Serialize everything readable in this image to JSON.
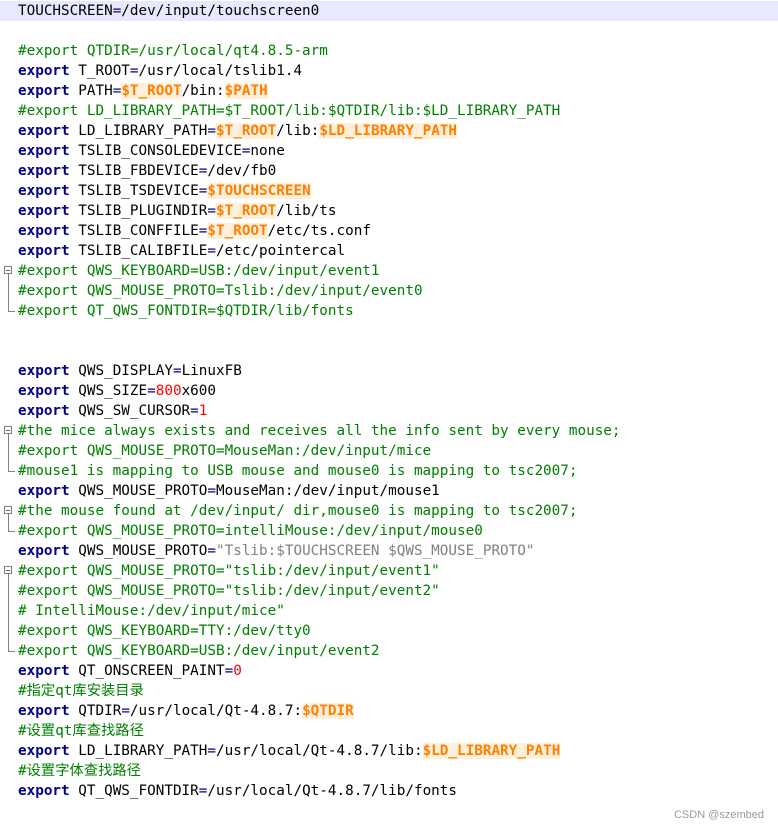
{
  "editor": {
    "lines": [
      {
        "hl": true,
        "fold": "none",
        "tokens": [
          {
            "t": "TOUCHSCREEN"
          },
          {
            "t": "=",
            "c": "op"
          },
          {
            "t": "/dev/input/touchscreen0"
          }
        ]
      },
      {
        "fold": "none",
        "tokens": []
      },
      {
        "fold": "none",
        "tokens": [
          {
            "t": "#export QTDIR=/usr/local/qt4.8.5-arm",
            "c": "cm"
          }
        ]
      },
      {
        "fold": "none",
        "tokens": [
          {
            "t": "export",
            "c": "kw"
          },
          {
            "t": " T_ROOT"
          },
          {
            "t": "=",
            "c": "op"
          },
          {
            "t": "/usr/local/tslib1.4"
          }
        ]
      },
      {
        "fold": "none",
        "tokens": [
          {
            "t": "export",
            "c": "kw"
          },
          {
            "t": " PATH"
          },
          {
            "t": "=",
            "c": "op"
          },
          {
            "t": "$T_ROOT",
            "c": "var"
          },
          {
            "t": "/bin:"
          },
          {
            "t": "$PATH",
            "c": "var"
          }
        ]
      },
      {
        "fold": "none",
        "tokens": [
          {
            "t": "#export LD_LIBRARY_PATH=$T_ROOT/lib:$QTDIR/lib:$LD_LIBRARY_PATH",
            "c": "cm"
          }
        ]
      },
      {
        "fold": "none",
        "tokens": [
          {
            "t": "export",
            "c": "kw"
          },
          {
            "t": " LD_LIBRARY_PATH"
          },
          {
            "t": "=",
            "c": "op"
          },
          {
            "t": "$T_ROOT",
            "c": "var"
          },
          {
            "t": "/lib:"
          },
          {
            "t": "$LD_LIBRARY_PATH",
            "c": "var"
          }
        ]
      },
      {
        "fold": "none",
        "tokens": [
          {
            "t": "export",
            "c": "kw"
          },
          {
            "t": " TSLIB_CONSOLEDEVICE"
          },
          {
            "t": "=",
            "c": "op"
          },
          {
            "t": "none"
          }
        ]
      },
      {
        "fold": "none",
        "tokens": [
          {
            "t": "export",
            "c": "kw"
          },
          {
            "t": " TSLIB_FBDEVICE"
          },
          {
            "t": "=",
            "c": "op"
          },
          {
            "t": "/dev/fb0"
          }
        ]
      },
      {
        "fold": "none",
        "tokens": [
          {
            "t": "export",
            "c": "kw"
          },
          {
            "t": " TSLIB_TSDEVICE"
          },
          {
            "t": "=",
            "c": "op"
          },
          {
            "t": "$TOUCHSCREEN",
            "c": "var"
          }
        ]
      },
      {
        "fold": "none",
        "tokens": [
          {
            "t": "export",
            "c": "kw"
          },
          {
            "t": " TSLIB_PLUGINDIR"
          },
          {
            "t": "=",
            "c": "op"
          },
          {
            "t": "$T_ROOT",
            "c": "var"
          },
          {
            "t": "/lib/ts"
          }
        ]
      },
      {
        "fold": "none",
        "tokens": [
          {
            "t": "export",
            "c": "kw"
          },
          {
            "t": " TSLIB_CONFFILE"
          },
          {
            "t": "=",
            "c": "op"
          },
          {
            "t": "$T_ROOT",
            "c": "var"
          },
          {
            "t": "/etc/ts.conf"
          }
        ]
      },
      {
        "fold": "none",
        "tokens": [
          {
            "t": "export",
            "c": "kw"
          },
          {
            "t": " TSLIB_CALIBFILE"
          },
          {
            "t": "=",
            "c": "op"
          },
          {
            "t": "/etc/pointercal"
          }
        ]
      },
      {
        "fold": "start",
        "tokens": [
          {
            "t": "#export QWS_KEYBOARD=USB:/dev/input/event1",
            "c": "cm"
          }
        ]
      },
      {
        "fold": "mid",
        "tokens": [
          {
            "t": "#export QWS_MOUSE_PROTO=Tslib:/dev/input/event0",
            "c": "cm"
          }
        ]
      },
      {
        "fold": "end",
        "tokens": [
          {
            "t": "#export QT_QWS_FONTDIR=$QTDIR/lib/fonts",
            "c": "cm"
          }
        ]
      },
      {
        "fold": "none",
        "tokens": []
      },
      {
        "fold": "none",
        "tokens": []
      },
      {
        "fold": "none",
        "tokens": [
          {
            "t": "export",
            "c": "kw"
          },
          {
            "t": " QWS_DISPLAY"
          },
          {
            "t": "=",
            "c": "op"
          },
          {
            "t": "LinuxFB"
          }
        ]
      },
      {
        "fold": "none",
        "tokens": [
          {
            "t": "export",
            "c": "kw"
          },
          {
            "t": " QWS_SIZE"
          },
          {
            "t": "=",
            "c": "op"
          },
          {
            "t": "800",
            "c": "num"
          },
          {
            "t": "x600"
          }
        ]
      },
      {
        "fold": "none",
        "tokens": [
          {
            "t": "export",
            "c": "kw"
          },
          {
            "t": " QWS_SW_CURSOR"
          },
          {
            "t": "=",
            "c": "op"
          },
          {
            "t": "1",
            "c": "num"
          }
        ]
      },
      {
        "fold": "start",
        "tokens": [
          {
            "t": "#the mice always exists and receives all the info sent by every mouse;",
            "c": "cm"
          }
        ]
      },
      {
        "fold": "mid",
        "tokens": [
          {
            "t": "#export QWS_MOUSE_PROTO=MouseMan:/dev/input/mice",
            "c": "cm"
          }
        ]
      },
      {
        "fold": "end",
        "tokens": [
          {
            "t": "#mouse1 is mapping to USB mouse and mouse0 is mapping to tsc2007;",
            "c": "cm"
          }
        ]
      },
      {
        "fold": "none",
        "tokens": [
          {
            "t": "export",
            "c": "kw"
          },
          {
            "t": " QWS_MOUSE_PROTO"
          },
          {
            "t": "=",
            "c": "op"
          },
          {
            "t": "MouseMan:/dev/input/mouse1"
          }
        ]
      },
      {
        "fold": "start",
        "tokens": [
          {
            "t": "#the mouse found at /dev/input/ dir,mouse0 is mapping to tsc2007;",
            "c": "cm"
          }
        ]
      },
      {
        "fold": "end",
        "tokens": [
          {
            "t": "#export QWS_MOUSE_PROTO=intelliMouse:/dev/input/mouse0",
            "c": "cm"
          }
        ]
      },
      {
        "fold": "none",
        "tokens": [
          {
            "t": "export",
            "c": "kw"
          },
          {
            "t": " QWS_MOUSE_PROTO"
          },
          {
            "t": "=",
            "c": "op"
          },
          {
            "t": "\"Tslib:$TOUCHSCREEN $QWS_MOUSE_PROTO\"",
            "c": "str"
          }
        ]
      },
      {
        "fold": "start",
        "tokens": [
          {
            "t": "#export QWS_MOUSE_PROTO=\"tslib:/dev/input/event1\"",
            "c": "cm"
          }
        ]
      },
      {
        "fold": "mid",
        "tokens": [
          {
            "t": "#export QWS_MOUSE_PROTO=\"tslib:/dev/input/event2\"",
            "c": "cm"
          }
        ]
      },
      {
        "fold": "mid",
        "tokens": [
          {
            "t": "# IntelliMouse:/dev/input/mice\"",
            "c": "cm"
          }
        ]
      },
      {
        "fold": "mid",
        "tokens": [
          {
            "t": "#export QWS_KEYBOARD=TTY:/dev/tty0",
            "c": "cm"
          }
        ]
      },
      {
        "fold": "end",
        "tokens": [
          {
            "t": "#export QWS_KEYBOARD=USB:/dev/input/event2",
            "c": "cm"
          }
        ]
      },
      {
        "fold": "none",
        "tokens": [
          {
            "t": "export",
            "c": "kw"
          },
          {
            "t": " QT_ONSCREEN_PAINT"
          },
          {
            "t": "=",
            "c": "op"
          },
          {
            "t": "0",
            "c": "num"
          }
        ]
      },
      {
        "fold": "none",
        "tokens": [
          {
            "t": "#指定qt库安装目录",
            "c": "cm"
          }
        ]
      },
      {
        "fold": "none",
        "tokens": [
          {
            "t": "export",
            "c": "kw"
          },
          {
            "t": " QTDIR"
          },
          {
            "t": "=",
            "c": "op"
          },
          {
            "t": "/usr/local/Qt-4.8.7:"
          },
          {
            "t": "$QTDIR",
            "c": "var"
          }
        ]
      },
      {
        "fold": "none",
        "tokens": [
          {
            "t": "#设置qt库查找路径",
            "c": "cm"
          }
        ]
      },
      {
        "fold": "none",
        "tokens": [
          {
            "t": "export",
            "c": "kw"
          },
          {
            "t": " LD_LIBRARY_PATH"
          },
          {
            "t": "=",
            "c": "op"
          },
          {
            "t": "/usr/local/Qt-4.8.7/lib:"
          },
          {
            "t": "$LD_LIBRARY_PATH",
            "c": "var"
          }
        ]
      },
      {
        "fold": "none",
        "tokens": [
          {
            "t": "#设置字体查找路径",
            "c": "cm"
          }
        ]
      },
      {
        "fold": "none",
        "tokens": [
          {
            "t": "export",
            "c": "kw"
          },
          {
            "t": " QT_QWS_FONTDIR"
          },
          {
            "t": "=",
            "c": "op"
          },
          {
            "t": "/usr/local/Qt-4.8.7/lib/fonts"
          }
        ]
      }
    ]
  },
  "watermark": "CSDN @szembed"
}
